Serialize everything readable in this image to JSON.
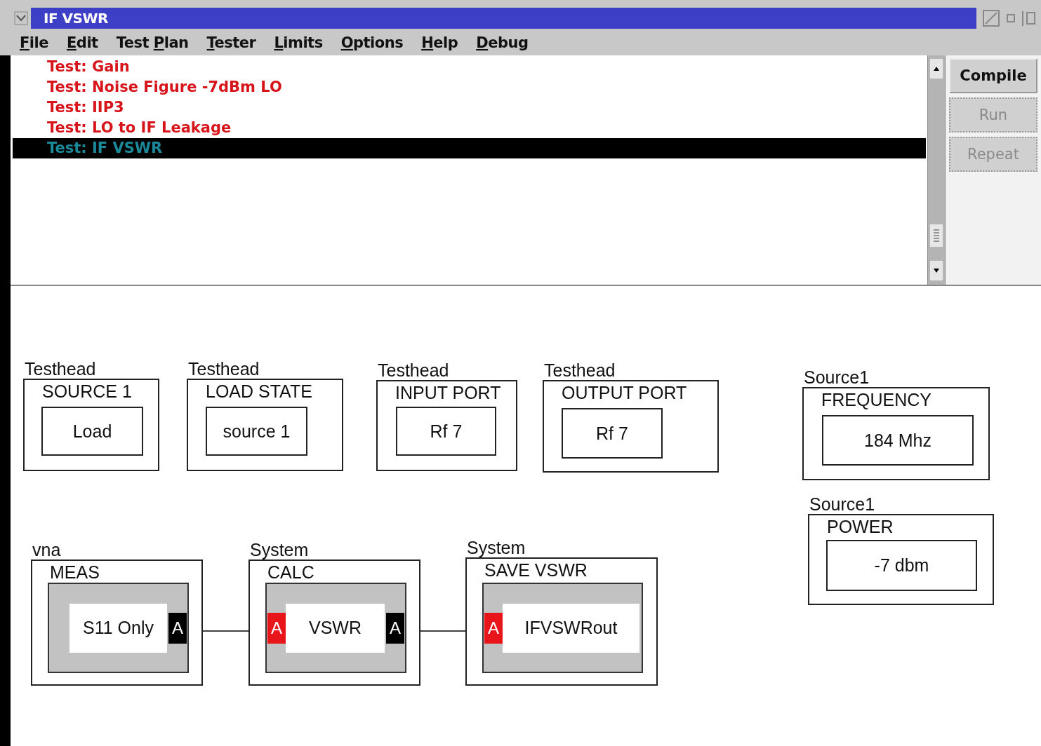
{
  "window": {
    "title": "IF VSWR"
  },
  "menu": [
    {
      "key": "F",
      "after": "ile"
    },
    {
      "key": "E",
      "after": "dit"
    },
    {
      "before": "Test ",
      "key": "P",
      "after": "lan"
    },
    {
      "key": "T",
      "after": "ester"
    },
    {
      "key": "L",
      "after": "imits"
    },
    {
      "key": "O",
      "after": "ptions"
    },
    {
      "key": "H",
      "after": "elp"
    },
    {
      "key": "D",
      "after": "ebug"
    }
  ],
  "tests": [
    {
      "label": "Test: Gain",
      "selected": false
    },
    {
      "label": "Test: Noise Figure -7dBm LO",
      "selected": false
    },
    {
      "label": "Test: IIP3",
      "selected": false
    },
    {
      "label": "Test: LO to IF Leakage",
      "selected": false
    },
    {
      "label": "Test: IF VSWR",
      "selected": true
    }
  ],
  "buttons": [
    {
      "label": "Compile",
      "disabled": false
    },
    {
      "label": "Run",
      "disabled": true
    },
    {
      "label": "Repeat",
      "disabled": true
    }
  ],
  "blocks": [
    {
      "kind": "param",
      "group": "Testhead",
      "title": "SOURCE 1",
      "value": "Load"
    },
    {
      "kind": "param",
      "group": "Testhead",
      "title": "LOAD STATE",
      "value": "source 1"
    },
    {
      "kind": "param",
      "group": "Testhead",
      "title": "INPUT PORT",
      "value": "Rf 7"
    },
    {
      "kind": "param",
      "group": "Testhead",
      "title": "OUTPUT PORT",
      "value": "Rf 7"
    },
    {
      "kind": "param",
      "group": "Source1",
      "title": "FREQUENCY",
      "value": "184  Mhz"
    },
    {
      "kind": "param",
      "group": "Source1",
      "title": "POWER",
      "value": "-7  dbm"
    },
    {
      "kind": "process",
      "group": "vna",
      "title": "MEAS",
      "value": "S11 Only",
      "ports": [
        {
          "kind": "output",
          "label": "A",
          "color": "#000000"
        }
      ]
    },
    {
      "kind": "process",
      "group": "System",
      "title": "CALC",
      "value": "VSWR",
      "ports": [
        {
          "kind": "input",
          "label": "A",
          "color": "#e8161b"
        },
        {
          "kind": "output",
          "label": "A",
          "color": "#000000"
        }
      ]
    },
    {
      "kind": "process",
      "group": "System",
      "title": "SAVE VSWR",
      "value": "IFVSWRout",
      "ports": [
        {
          "kind": "input",
          "label": "A",
          "color": "#e8161b"
        }
      ]
    }
  ]
}
